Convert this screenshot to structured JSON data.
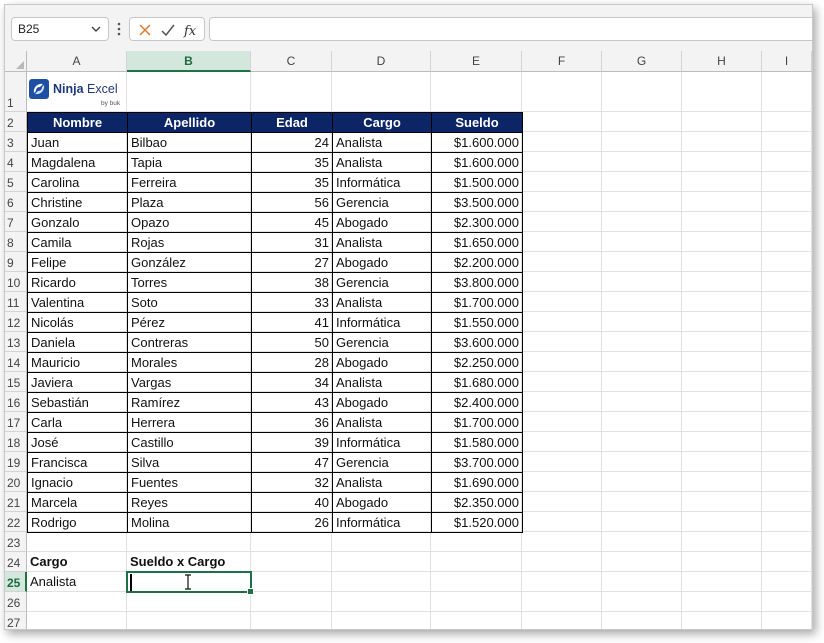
{
  "formula_bar": {
    "name_box": "B25",
    "name_box_icon": "chevron-down-icon",
    "cancel_icon": "x-icon",
    "enter_icon": "check-icon",
    "function_icon": "fx-icon",
    "formula": ""
  },
  "columns": [
    "A",
    "B",
    "C",
    "D",
    "E",
    "F",
    "G",
    "H",
    "I"
  ],
  "active_column": "B",
  "rows": [
    "1",
    "2",
    "3",
    "4",
    "5",
    "6",
    "7",
    "8",
    "9",
    "10",
    "11",
    "12",
    "13",
    "14",
    "15",
    "16",
    "17",
    "18",
    "19",
    "20",
    "21",
    "22",
    "23",
    "24",
    "25",
    "26",
    "27"
  ],
  "active_row": "25",
  "logo": {
    "brand": "Ninja",
    "brand2": "Excel",
    "sub": "by buk"
  },
  "table": {
    "headers": [
      "Nombre",
      "Apellido",
      "Edad",
      "Cargo",
      "Sueldo"
    ],
    "rows": [
      [
        "Juan",
        "Bilbao",
        "24",
        "Analista",
        "$1.600.000"
      ],
      [
        "Magdalena",
        "Tapia",
        "35",
        "Analista",
        "$1.600.000"
      ],
      [
        "Carolina",
        "Ferreira",
        "35",
        "Informática",
        "$1.500.000"
      ],
      [
        "Christine",
        "Plaza",
        "56",
        "Gerencia",
        "$3.500.000"
      ],
      [
        "Gonzalo",
        "Opazo",
        "45",
        "Abogado",
        "$2.300.000"
      ],
      [
        "Camila",
        "Rojas",
        "31",
        "Analista",
        "$1.650.000"
      ],
      [
        "Felipe",
        "González",
        "27",
        "Abogado",
        "$2.200.000"
      ],
      [
        "Ricardo",
        "Torres",
        "38",
        "Gerencia",
        "$3.800.000"
      ],
      [
        "Valentina",
        "Soto",
        "33",
        "Analista",
        "$1.700.000"
      ],
      [
        "Nicolás",
        "Pérez",
        "41",
        "Informática",
        "$1.550.000"
      ],
      [
        "Daniela",
        "Contreras",
        "50",
        "Gerencia",
        "$3.600.000"
      ],
      [
        "Mauricio",
        "Morales",
        "28",
        "Abogado",
        "$2.250.000"
      ],
      [
        "Javiera",
        "Vargas",
        "34",
        "Analista",
        "$1.680.000"
      ],
      [
        "Sebastián",
        "Ramírez",
        "43",
        "Abogado",
        "$2.400.000"
      ],
      [
        "Carla",
        "Herrera",
        "36",
        "Analista",
        "$1.700.000"
      ],
      [
        "José",
        "Castillo",
        "39",
        "Informática",
        "$1.580.000"
      ],
      [
        "Francisca",
        "Silva",
        "47",
        "Gerencia",
        "$3.700.000"
      ],
      [
        "Ignacio",
        "Fuentes",
        "32",
        "Analista",
        "$1.690.000"
      ],
      [
        "Marcela",
        "Reyes",
        "40",
        "Abogado",
        "$2.350.000"
      ],
      [
        "Rodrigo",
        "Molina",
        "26",
        "Informática",
        "$1.520.000"
      ]
    ]
  },
  "lookup": {
    "header_cargo": "Cargo",
    "header_sueldo": "Sueldo x Cargo",
    "value_cargo": "Analista",
    "value_sueldo": ""
  },
  "colors": {
    "header_fill": "#0c2566",
    "selection": "#1e7145"
  }
}
